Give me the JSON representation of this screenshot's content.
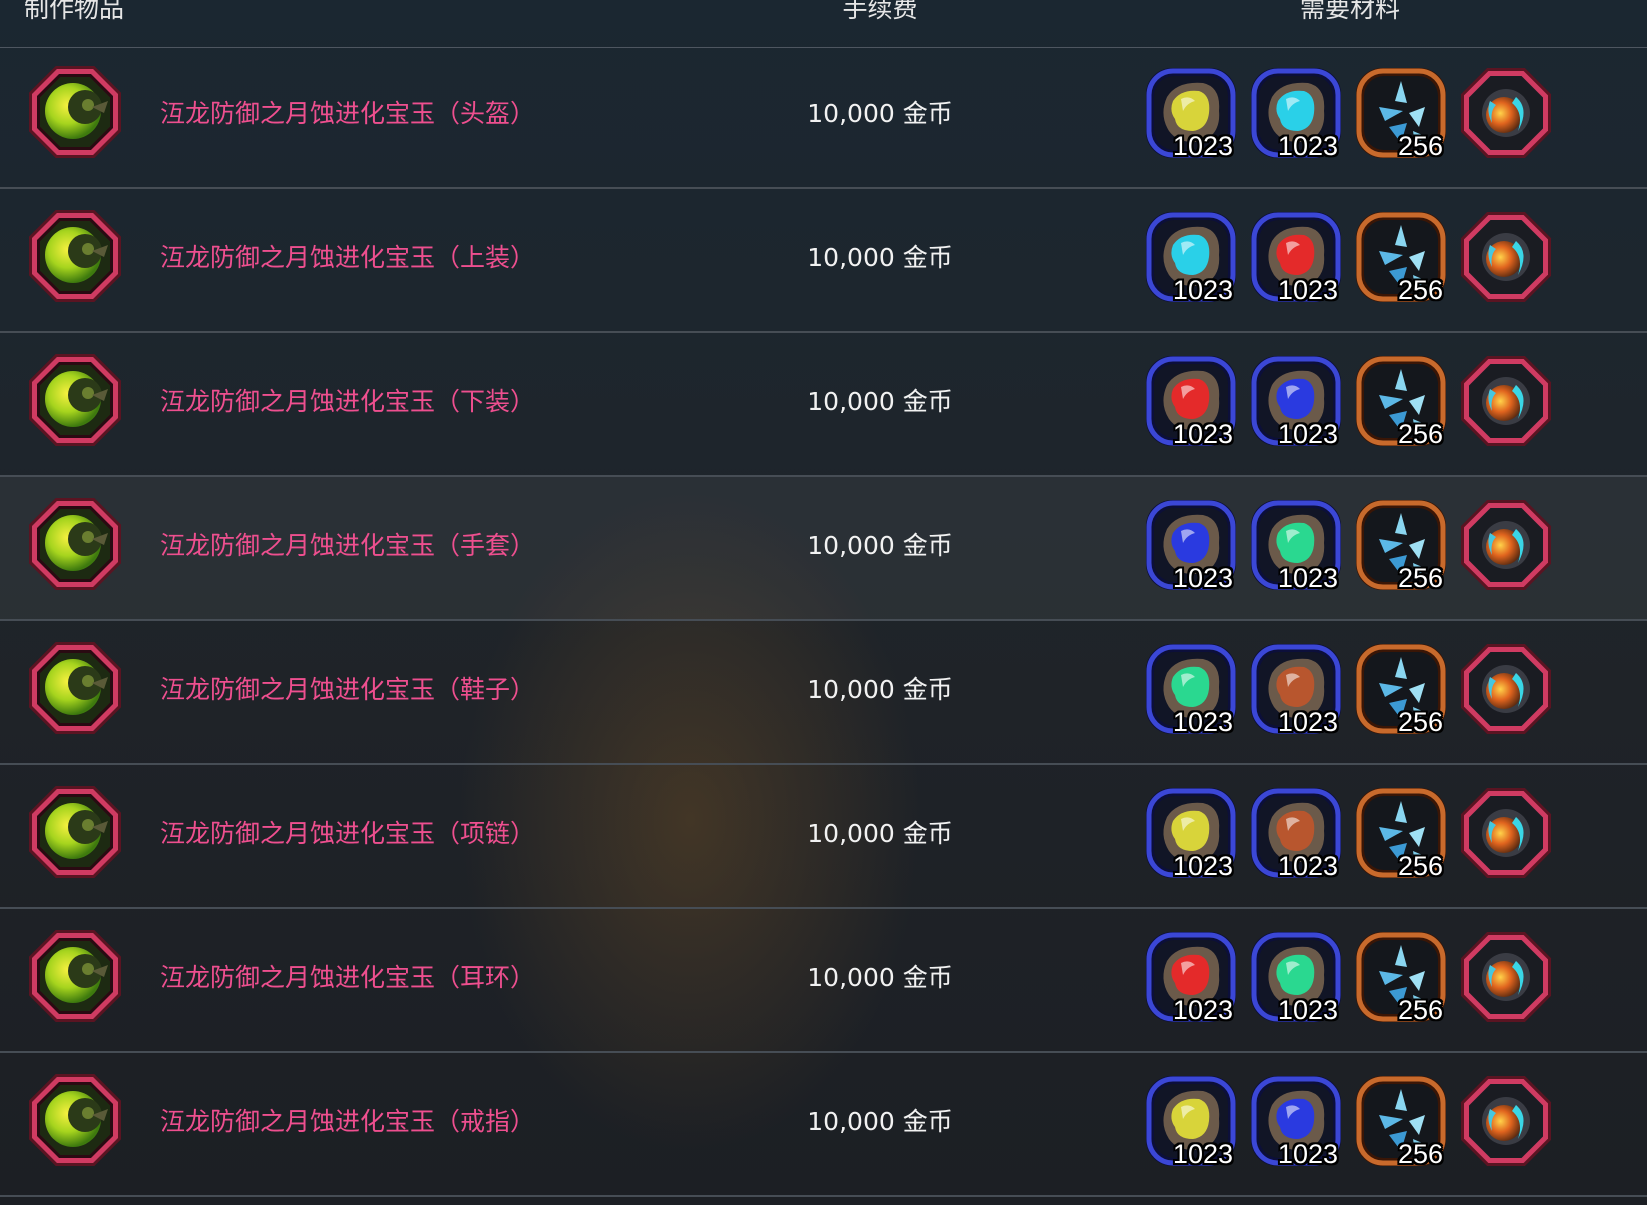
{
  "header": {
    "item_label": "制作物品",
    "fee_label": "手续费",
    "materials_label": "需要材料"
  },
  "colors": {
    "item_name": "#ee4f8f",
    "rare_frame": "#c8335a",
    "blue_frame": "#2a34b8",
    "bronze_frame": "#b8602a"
  },
  "rows": [
    {
      "icon": "crescent-moon-gem-icon",
      "name": "沍龙防御之月蚀进化宝玉（头盔）",
      "fee": "10,000 金币",
      "materials": [
        {
          "icon": "yellow-gem-ore-icon",
          "gem_color": "#d8d43a",
          "qty": "1023"
        },
        {
          "icon": "cyan-gem-ore-icon",
          "gem_color": "#2ad0e8",
          "qty": "1023"
        },
        {
          "icon": "crystal-shard-icon",
          "qty": "256"
        },
        {
          "icon": "fire-ice-orb-icon",
          "qty": ""
        }
      ]
    },
    {
      "icon": "crescent-moon-gem-icon",
      "name": "沍龙防御之月蚀进化宝玉（上装）",
      "fee": "10,000 金币",
      "materials": [
        {
          "icon": "cyan-gem-ore-icon",
          "gem_color": "#2ad0e8",
          "qty": "1023"
        },
        {
          "icon": "red-gem-ore-icon",
          "gem_color": "#e42a2a",
          "qty": "1023"
        },
        {
          "icon": "crystal-shard-icon",
          "qty": "256"
        },
        {
          "icon": "fire-ice-orb-icon",
          "qty": ""
        }
      ]
    },
    {
      "icon": "crescent-moon-gem-icon",
      "name": "沍龙防御之月蚀进化宝玉（下装）",
      "fee": "10,000 金币",
      "materials": [
        {
          "icon": "red-gem-ore-icon",
          "gem_color": "#e42a2a",
          "qty": "1023"
        },
        {
          "icon": "blue-gem-ore-icon",
          "gem_color": "#2a3ae0",
          "qty": "1023"
        },
        {
          "icon": "crystal-shard-icon",
          "qty": "256"
        },
        {
          "icon": "fire-ice-orb-icon",
          "qty": ""
        }
      ]
    },
    {
      "icon": "crescent-moon-gem-icon",
      "name": "沍龙防御之月蚀进化宝玉（手套）",
      "fee": "10,000 金币",
      "materials": [
        {
          "icon": "blue-gem-ore-icon",
          "gem_color": "#2a3ae0",
          "qty": "1023"
        },
        {
          "icon": "green-gem-ore-icon",
          "gem_color": "#2ad890",
          "qty": "1023"
        },
        {
          "icon": "crystal-shard-icon",
          "qty": "256"
        },
        {
          "icon": "fire-ice-orb-icon",
          "qty": ""
        }
      ]
    },
    {
      "icon": "crescent-moon-gem-icon",
      "name": "沍龙防御之月蚀进化宝玉（鞋子）",
      "fee": "10,000 金币",
      "materials": [
        {
          "icon": "green-gem-ore-icon",
          "gem_color": "#2ad890",
          "qty": "1023"
        },
        {
          "icon": "brown-gem-ore-icon",
          "gem_color": "#b8562e",
          "qty": "1023"
        },
        {
          "icon": "crystal-shard-icon",
          "qty": "256"
        },
        {
          "icon": "fire-ice-orb-icon",
          "qty": ""
        }
      ]
    },
    {
      "icon": "crescent-moon-gem-icon",
      "name": "沍龙防御之月蚀进化宝玉（项链）",
      "fee": "10,000 金币",
      "materials": [
        {
          "icon": "yellow-gem-ore-icon",
          "gem_color": "#d8d43a",
          "qty": "1023"
        },
        {
          "icon": "brown-gem-ore-icon",
          "gem_color": "#b8562e",
          "qty": "1023"
        },
        {
          "icon": "crystal-shard-icon",
          "qty": "256"
        },
        {
          "icon": "fire-ice-orb-icon",
          "qty": ""
        }
      ]
    },
    {
      "icon": "crescent-moon-gem-icon",
      "name": "沍龙防御之月蚀进化宝玉（耳环）",
      "fee": "10,000 金币",
      "materials": [
        {
          "icon": "red-gem-ore-icon",
          "gem_color": "#e42a2a",
          "qty": "1023"
        },
        {
          "icon": "green-gem-ore-icon",
          "gem_color": "#2ad890",
          "qty": "1023"
        },
        {
          "icon": "crystal-shard-icon",
          "qty": "256"
        },
        {
          "icon": "fire-ice-orb-icon",
          "qty": ""
        }
      ]
    },
    {
      "icon": "crescent-moon-gem-icon",
      "name": "沍龙防御之月蚀进化宝玉（戒指）",
      "fee": "10,000 金币",
      "materials": [
        {
          "icon": "yellow-gem-ore-icon",
          "gem_color": "#d8d43a",
          "qty": "1023"
        },
        {
          "icon": "blue-gem-ore-icon",
          "gem_color": "#2a3ae0",
          "qty": "1023"
        },
        {
          "icon": "crystal-shard-icon",
          "qty": "256"
        },
        {
          "icon": "fire-ice-orb-icon",
          "qty": ""
        }
      ]
    }
  ]
}
